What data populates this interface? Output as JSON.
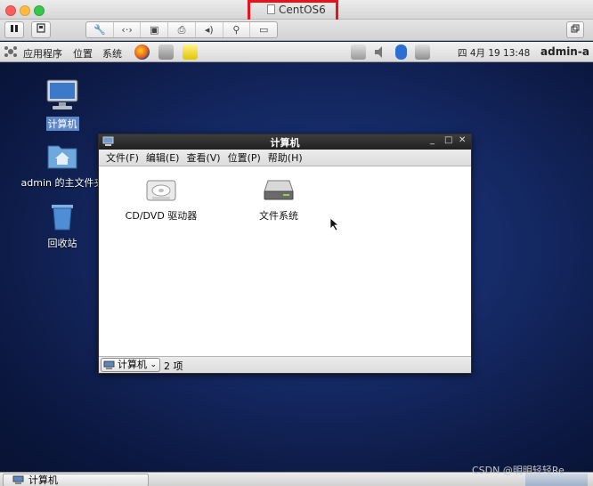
{
  "vm": {
    "title": "CentOS6"
  },
  "panel": {
    "applications": "应用程序",
    "places": "位置",
    "system": "系统",
    "clock": "四 4月 19 13:48",
    "user": "admin-a"
  },
  "desktop": {
    "icons": [
      {
        "label": "计算机"
      },
      {
        "label": "admin 的主文件夹"
      },
      {
        "label": "回收站"
      }
    ]
  },
  "file_manager": {
    "title": "计算机",
    "menus": [
      "文件(F)",
      "编辑(E)",
      "查看(V)",
      "位置(P)",
      "帮助(H)"
    ],
    "items": [
      {
        "label": "CD/DVD 驱动器"
      },
      {
        "label": "文件系统"
      }
    ],
    "location": "计算机",
    "item_count": "2 项"
  },
  "taskbar": {
    "task_label": "计算机"
  },
  "watermark": "CSDN @明明轻轻Re",
  "colors": {
    "highlight": "#e8121a",
    "desktop_bg": "#152a66",
    "selection": "#5d87c7"
  }
}
